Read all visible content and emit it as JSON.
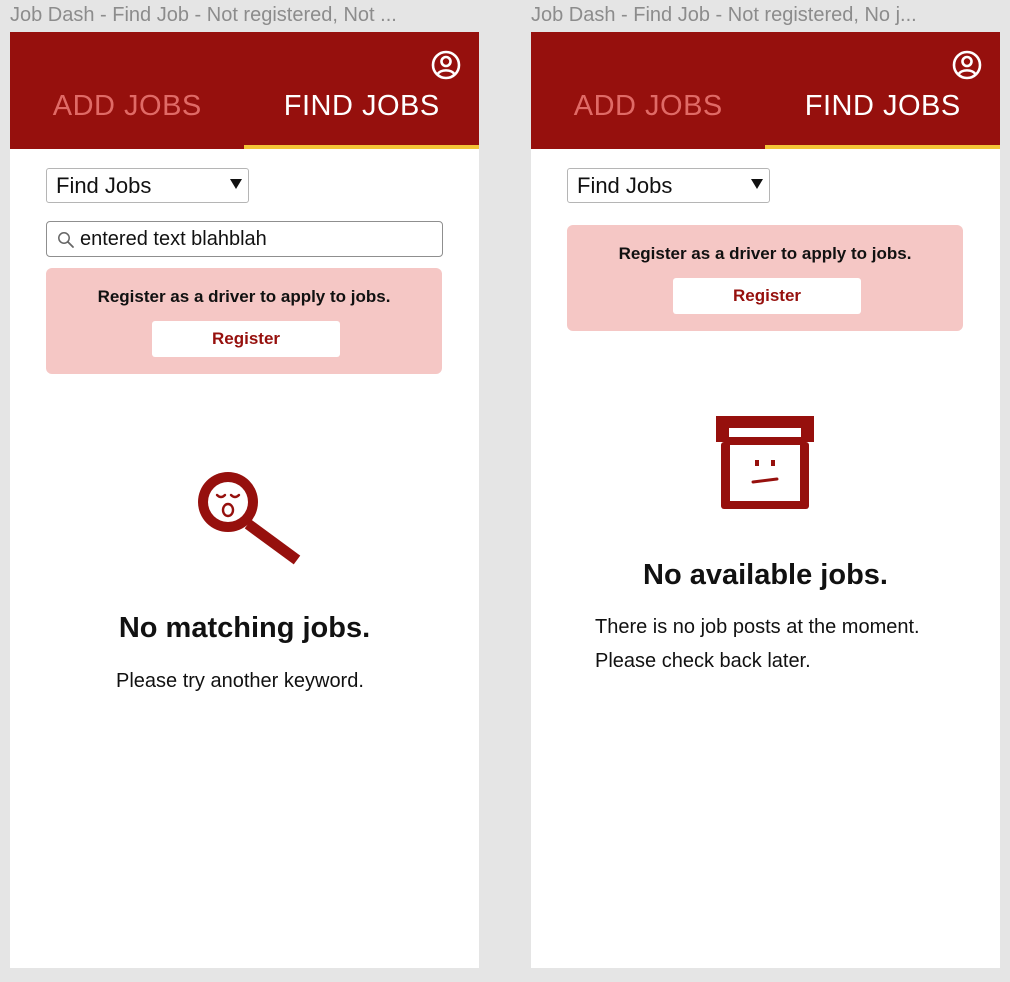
{
  "frames": [
    {
      "label": "Job Dash - Find Job - Not registered, Not ...",
      "tabs": {
        "add": "ADD JOBS",
        "find": "FIND JOBS"
      },
      "dropdown_value": "Find Jobs",
      "search_value": "entered text blahblah",
      "banner": {
        "text": "Register as a driver to apply to jobs.",
        "button": "Register"
      },
      "empty": {
        "icon": "sad-magnifier-icon",
        "title": "No matching jobs.",
        "line1": "Please try another keyword."
      }
    },
    {
      "label": "Job Dash - Find Job - Not registered, No j...",
      "tabs": {
        "add": "ADD JOBS",
        "find": "FIND JOBS"
      },
      "dropdown_value": "Find Jobs",
      "banner": {
        "text": "Register as a driver to apply to jobs.",
        "button": "Register"
      },
      "empty": {
        "icon": "empty-box-icon",
        "title": "No available jobs.",
        "line1": "There is no job posts at the moment.",
        "line2": "Please check back later."
      }
    }
  ],
  "colors": {
    "brand": "#96100d",
    "tab_inactive": "#e06a66",
    "tab_indicator": "#f3c437",
    "banner_bg": "#f5c7c5"
  }
}
